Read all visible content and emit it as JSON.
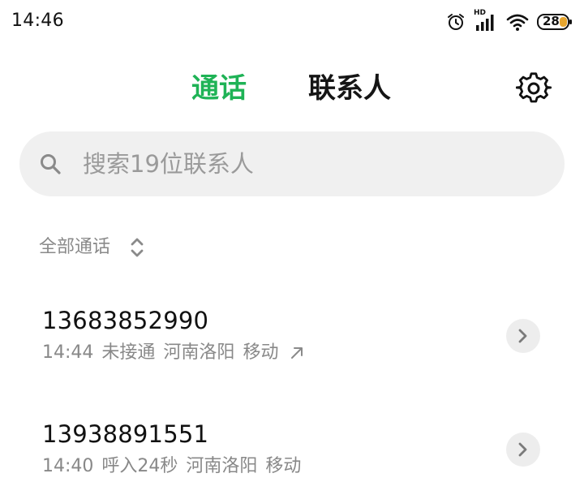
{
  "status_bar": {
    "time": "14:46",
    "network_label": "HD",
    "battery_level": "28",
    "icons": [
      "alarm-icon",
      "signal-icon",
      "wifi-icon",
      "battery-icon"
    ]
  },
  "header": {
    "tabs": [
      {
        "label": "通话",
        "active": true
      },
      {
        "label": "联系人",
        "active": false
      }
    ],
    "settings_icon": "gear-icon"
  },
  "search": {
    "placeholder": "搜索19位联系人"
  },
  "filter": {
    "label": "全部通话"
  },
  "calls": [
    {
      "number": "13683852990",
      "time": "14:44",
      "status": "未接通",
      "location": "河南洛阳",
      "carrier": "移动",
      "direction_icon": "outgoing-call-icon"
    },
    {
      "number": "13938891551",
      "time": "14:40",
      "status": "呼入24秒",
      "location": "河南洛阳",
      "carrier": "移动"
    }
  ],
  "colors": {
    "accent": "#1fb356",
    "search_bg": "#f0f0f0",
    "secondary_text": "#888888"
  }
}
